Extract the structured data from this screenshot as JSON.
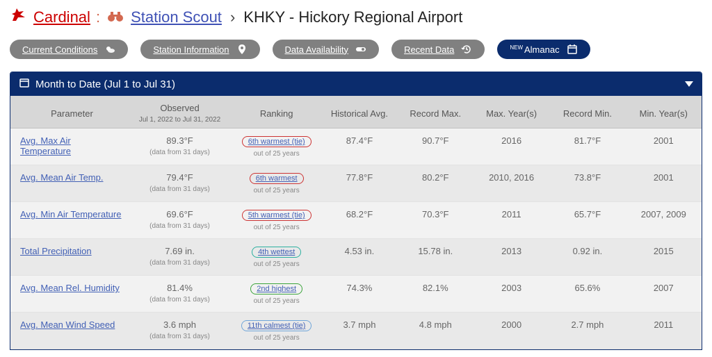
{
  "header": {
    "cardinal": "Cardinal",
    "scout": "Station Scout",
    "station": "KHKY - Hickory Regional Airport"
  },
  "tabs": {
    "current": "Current Conditions",
    "info": "Station Information",
    "avail": "Data Availability",
    "recent": "Recent Data",
    "almanac_new": "NEW",
    "almanac": "Almanac"
  },
  "panel": {
    "title": "Month to Date (Jul 1 to Jul 31)"
  },
  "columns": {
    "param": "Parameter",
    "observed": "Observed",
    "observed_sub": "Jul 1, 2022 to Jul 31, 2022",
    "ranking": "Ranking",
    "hist": "Historical Avg.",
    "recmax": "Record Max.",
    "maxyear": "Max. Year(s)",
    "recmin": "Record Min.",
    "minyear": "Min. Year(s)"
  },
  "rows": [
    {
      "param": "Avg. Max Air Temperature",
      "obs": "89.3°F",
      "obs_note": "(data from 31 days)",
      "rank": "6th warmest (tie)",
      "rank_sub": "out of 25 years",
      "rank_class": "rank-red",
      "hist": "87.4°F",
      "recmax": "90.7°F",
      "maxyear": "2016",
      "recmin": "81.7°F",
      "minyear": "2001"
    },
    {
      "param": "Avg. Mean Air Temp.",
      "obs": "79.4°F",
      "obs_note": "(data from 31 days)",
      "rank": "6th warmest",
      "rank_sub": "out of 25 years",
      "rank_class": "rank-red",
      "hist": "77.8°F",
      "recmax": "80.2°F",
      "maxyear": "2010, 2016",
      "recmin": "73.8°F",
      "minyear": "2001"
    },
    {
      "param": "Avg. Min Air Temperature",
      "obs": "69.6°F",
      "obs_note": "(data from 31 days)",
      "rank": "5th warmest (tie)",
      "rank_sub": "out of 25 years",
      "rank_class": "rank-red",
      "hist": "68.2°F",
      "recmax": "70.3°F",
      "maxyear": "2011",
      "recmin": "65.7°F",
      "minyear": "2007, 2009"
    },
    {
      "param": "Total Precipitation",
      "obs": "7.69 in.",
      "obs_note": "(data from 31 days)",
      "rank": "4th wettest",
      "rank_sub": "out of 25 years",
      "rank_class": "rank-teal",
      "hist": "4.53 in.",
      "recmax": "15.78 in.",
      "maxyear": "2013",
      "recmin": "0.92 in.",
      "minyear": "2015"
    },
    {
      "param": "Avg. Mean Rel. Humidity",
      "obs": "81.4%",
      "obs_note": "(data from 31 days)",
      "rank": "2nd highest",
      "rank_sub": "out of 25 years",
      "rank_class": "rank-green",
      "hist": "74.3%",
      "recmax": "82.1%",
      "maxyear": "2003",
      "recmin": "65.6%",
      "minyear": "2007"
    },
    {
      "param": "Avg. Mean Wind Speed",
      "obs": "3.6 mph",
      "obs_note": "(data from 31 days)",
      "rank": "11th calmest (tie)",
      "rank_sub": "out of 25 years",
      "rank_class": "rank-blue",
      "hist": "3.7 mph",
      "recmax": "4.8 mph",
      "maxyear": "2000",
      "recmin": "2.7 mph",
      "minyear": "2011"
    }
  ]
}
